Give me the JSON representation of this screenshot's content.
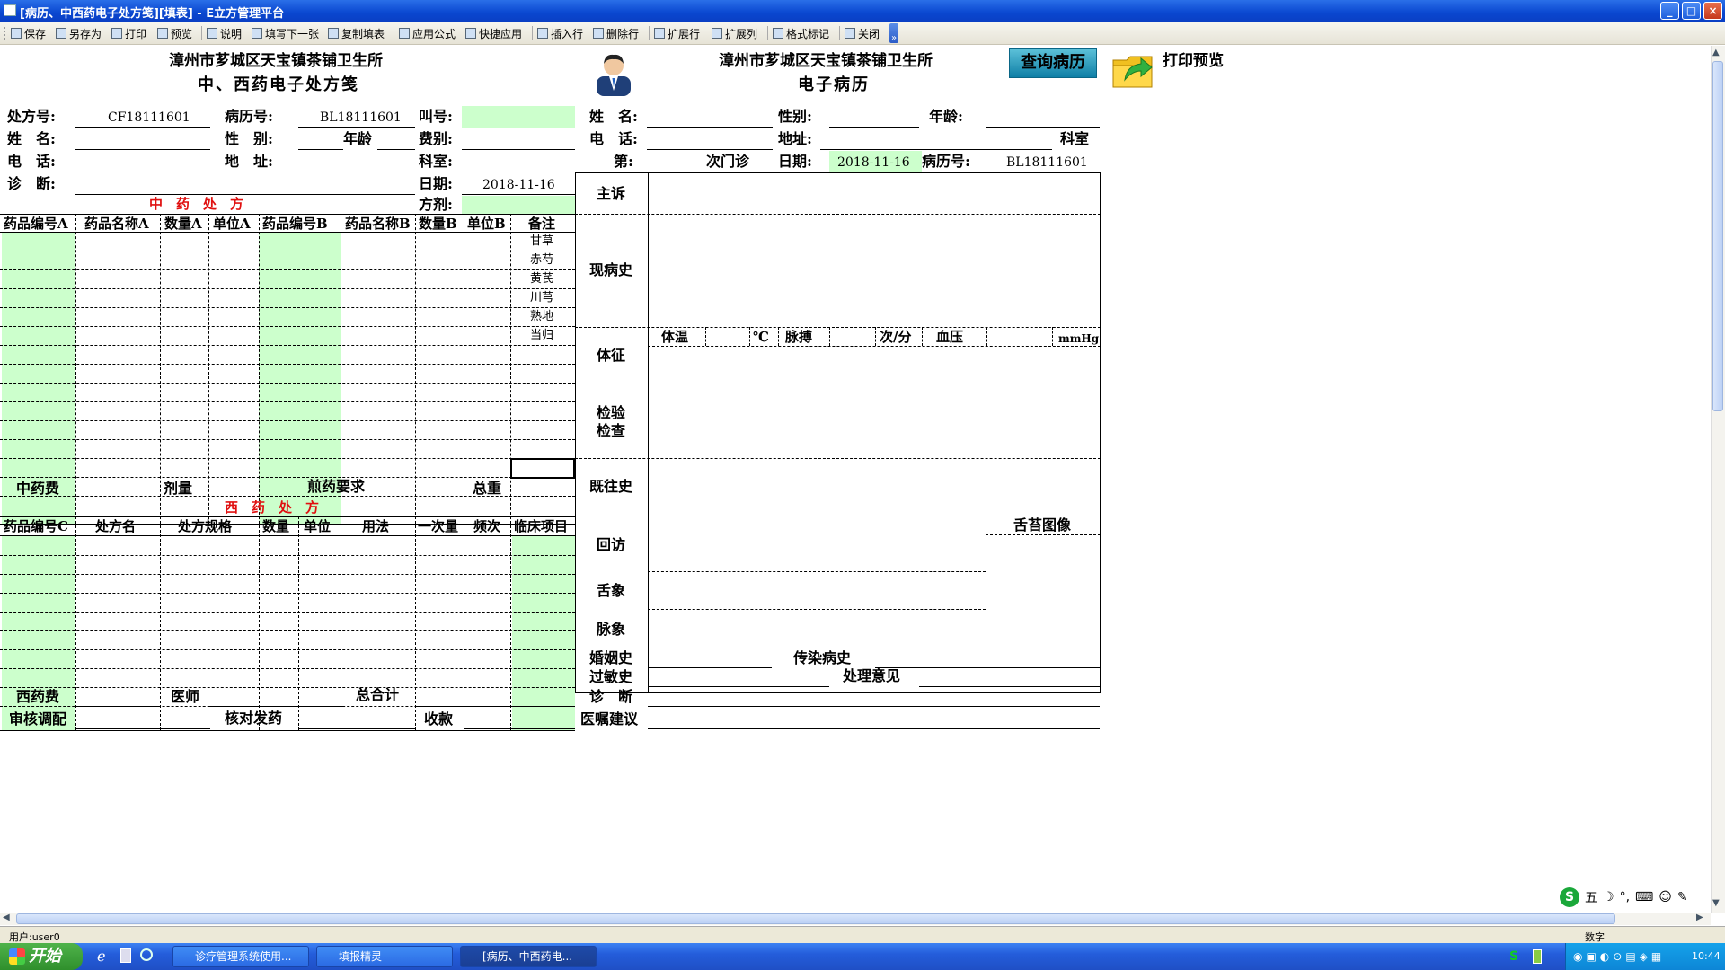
{
  "window": {
    "title": "[病历、中西药电子处方笺][填表] - E立方管理平台",
    "min": "_",
    "max": "□",
    "close": "×"
  },
  "toolbar": [
    "保存",
    "另存为",
    "打印",
    "预览",
    "说明",
    "填写下一张",
    "复制填表",
    "应用公式",
    "快捷应用",
    "插入行",
    "删除行",
    "扩展行",
    "扩展列",
    "格式标记",
    "关闭"
  ],
  "toolbar_more": "»",
  "rx": {
    "clinic": "漳州市芗城区天宝镇茶铺卫生所",
    "title": "中、西药电子处方笺",
    "labels": {
      "rx_no": "处方号:",
      "record_no": "病历号:",
      "call_no": "叫号:",
      "name": "姓　名:",
      "gender": "性　别:",
      "age": "年龄",
      "fee_type": "费别:",
      "phone": "电　话:",
      "address": "地　址:",
      "dept": "科室:",
      "diagnosis": "诊　断:",
      "date": "日期:",
      "formula": "方剂:"
    },
    "values": {
      "rx_no": "CF18111601",
      "record_no": "BL18111601",
      "date": "2018-11-16"
    },
    "tcm_heading": "中　药　处　方",
    "tcm_headers": [
      "药品编号A",
      "药品名称A",
      "数量A",
      "单位A",
      "药品编号B",
      "药品名称B",
      "数量B",
      "单位B",
      "备注"
    ],
    "remarks": [
      "甘草",
      "赤芍",
      "黄芪",
      "川芎",
      "熟地",
      "当归"
    ],
    "tcm_footer": {
      "fee": "中药费",
      "dose": "剂量",
      "decoct": "煎药要求",
      "weight": "总重"
    },
    "wm_heading": "西　药　处　方",
    "wm_headers": [
      "药品编号C",
      "处方名",
      "处方规格",
      "数量",
      "单位",
      "用法",
      "一次量",
      "频次",
      "临床项目"
    ],
    "wm_footer": {
      "fee": "西药费",
      "doctor": "医师",
      "total": "总合计",
      "review": "审核调配",
      "check": "核对发药",
      "cashier": "收款"
    }
  },
  "emr": {
    "clinic": "漳州市芗城区天宝镇茶铺卫生所",
    "title": "电子病历",
    "labels": {
      "name": "姓　名:",
      "gender": "性别:",
      "age": "年龄:",
      "phone": "电　话:",
      "address": "地址:",
      "dept": "科室",
      "visit": "第:",
      "visit_suffix": "次门诊",
      "date": "日期:",
      "record_no": "病历号:"
    },
    "values": {
      "date": "2018-11-16",
      "record_no": "BL18111601"
    },
    "sections": {
      "complaint": "主诉",
      "present": "现病史",
      "signs": "体征",
      "exam": "检验检查",
      "past": "既往史",
      "followup": "回访",
      "tongue": "舌象",
      "pulse": "脉象",
      "tongue_img": "舌苔图像"
    },
    "vitals": {
      "temp": "体温",
      "temp_unit": "℃",
      "pulse": "脉搏",
      "pulse_unit": "次/分",
      "bp": "血压",
      "bp_unit": "mmHg"
    },
    "bottom": {
      "marriage": "婚姻史",
      "infect": "传染病史",
      "allergy": "过敏史",
      "opinion": "处理意见",
      "diag": "诊　断",
      "advice": "医嘱建议"
    }
  },
  "actions": {
    "query": "查询病历",
    "print_preview": "打印预览"
  },
  "statusbar": {
    "user": "用户:user0",
    "mode": "数字"
  },
  "taskbar": {
    "start": "开始",
    "tasks": [
      "诊疗管理系统使用...",
      "填报精灵",
      "[病历、中西药电..."
    ],
    "clock": "10:44",
    "ime": "五"
  }
}
